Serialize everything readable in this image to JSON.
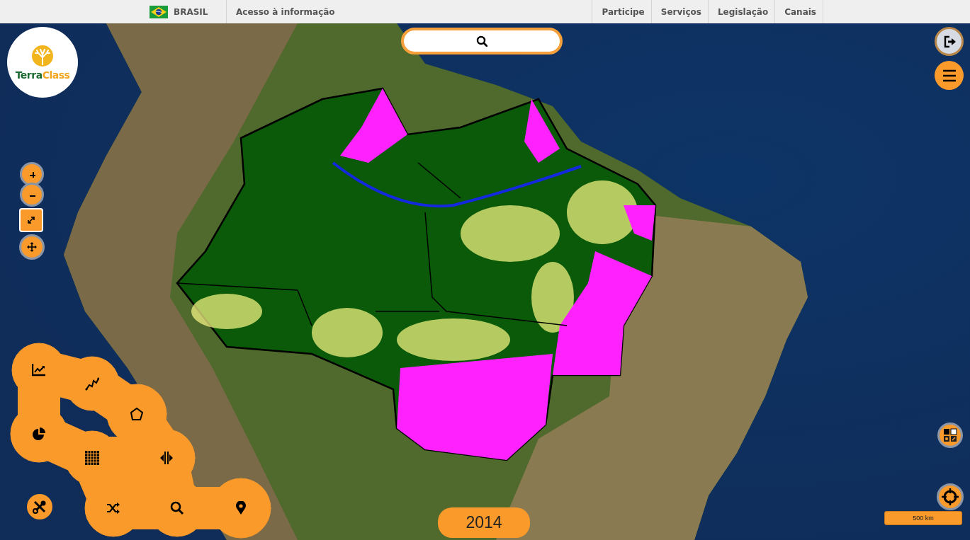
{
  "top_bar": {
    "country": "BRASIL",
    "info_link": "Acesso à informação",
    "menu": [
      {
        "label": "Participe"
      },
      {
        "label": "Serviços"
      },
      {
        "label": "Legislação"
      },
      {
        "label": "Canais"
      }
    ]
  },
  "logo": {
    "parts": [
      "Terra",
      "Class"
    ]
  },
  "year": "2014",
  "scale": "500 km"
}
